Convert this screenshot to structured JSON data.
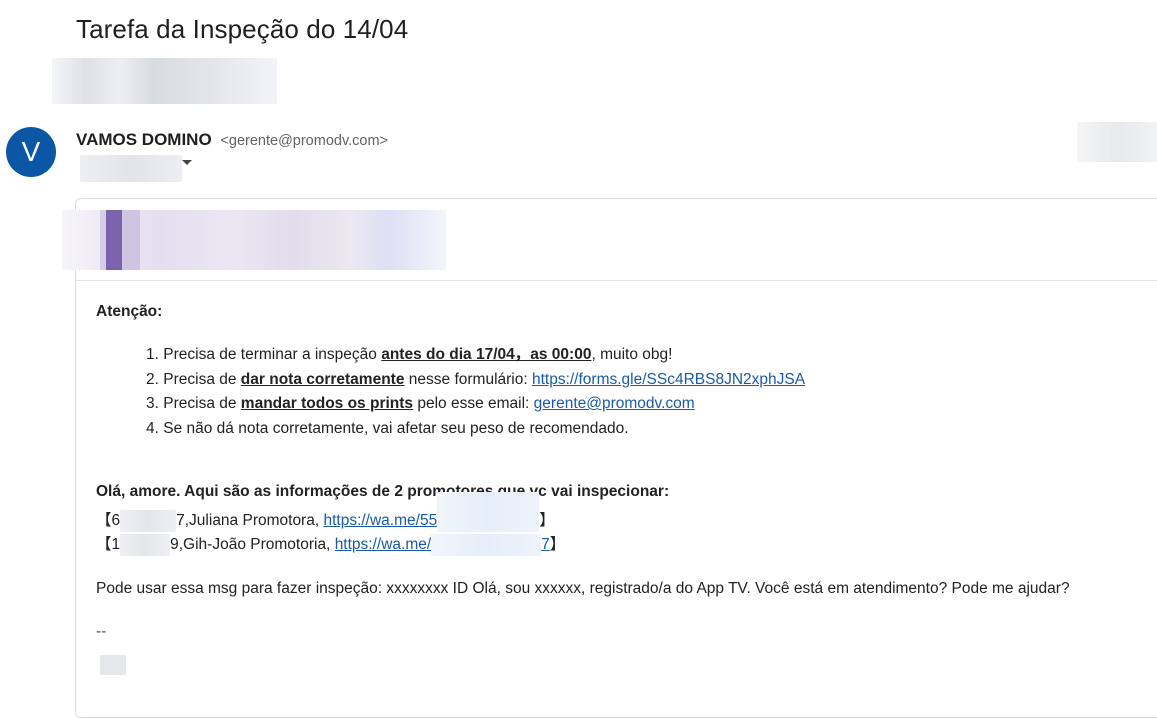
{
  "email": {
    "subject": "Tarefa da Inspeção do 14/04",
    "sender": {
      "avatar_letter": "V",
      "name": "VAMOS DOMINO",
      "email": "<gerente@promodv.com>"
    },
    "body": {
      "attention": "Atenção:",
      "items": [
        {
          "num": "1.",
          "pre": "Precisa de terminar a inspeção ",
          "bold": "antes do dia 17/04，as 00:00",
          "post": ", muito obg!",
          "link": ""
        },
        {
          "num": "2.",
          "pre": "Precisa de ",
          "bold": "dar nota corretamente",
          "post": " nesse formulário: ",
          "link": "https://forms.gle/SSc4RBS8JN2xphJSA"
        },
        {
          "num": "3.",
          "pre": "Precisa de ",
          "bold": "mandar todos os prints",
          "post": " pelo esse email: ",
          "link": "gerente@promodv.com"
        },
        {
          "num": "4.",
          "pre": "Se não dá nota corretamente, vai afetar seu peso de recomendado.",
          "bold": "",
          "post": "",
          "link": ""
        }
      ],
      "greeting": "Olá, amore. Aqui são as informações de 2 promotores que vc vai inspecionar:",
      "promoters": [
        {
          "open": "【6",
          "tail": "7",
          "name": ",Juliana Promotora, ",
          "link": "https://wa.me/55",
          "close": "】"
        },
        {
          "open": "【1",
          "tail": "9",
          "name": ",Gih-João Promotoria, ",
          "link": "https://wa.me/",
          "link_tail": "7",
          "close": "】"
        }
      ],
      "message": "Pode usar essa msg para fazer inspeção: xxxxxxxx ID Olá, sou xxxxxx, registrado/a do App TV. Você está em atendimento? Pode me ajudar?",
      "signature": "--"
    }
  },
  "colors": {
    "avatar_bg": "#0b57a5",
    "link": "#1a5aa6"
  }
}
